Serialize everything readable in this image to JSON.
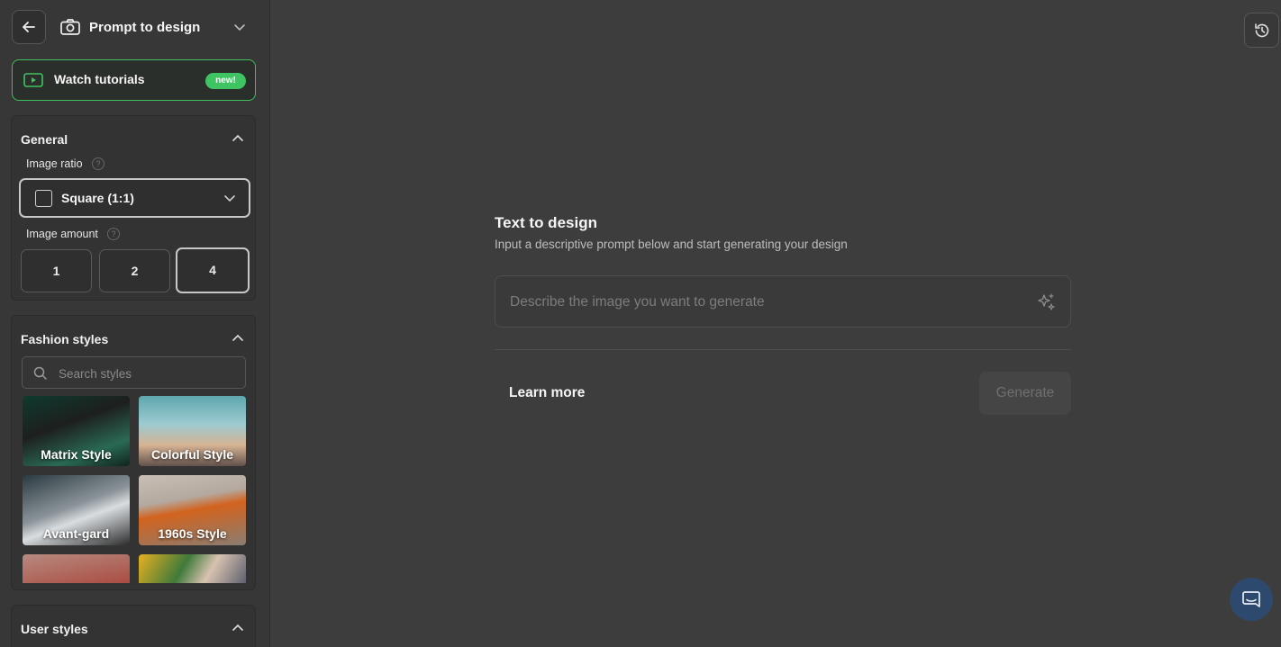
{
  "sidebar": {
    "mode_title": "Prompt to design",
    "tutorial": {
      "label": "Watch tutorials",
      "badge": "new!"
    },
    "general": {
      "title": "General",
      "image_ratio": {
        "label": "Image ratio",
        "help": "?",
        "value": "Square (1:1)"
      },
      "image_amount": {
        "label": "Image amount",
        "help": "?",
        "options": [
          "1",
          "2",
          "4"
        ],
        "selected": "4"
      }
    },
    "fashion_styles": {
      "title": "Fashion styles",
      "search_placeholder": "Search styles",
      "styles": [
        {
          "name": "Matrix Style"
        },
        {
          "name": "Colorful Style"
        },
        {
          "name": "Avant-gard"
        },
        {
          "name": "1960s Style"
        },
        {
          "name": ""
        },
        {
          "name": ""
        }
      ]
    },
    "user_styles": {
      "title": "User styles"
    }
  },
  "main": {
    "title": "Text to design",
    "subtitle": "Input a descriptive prompt below and start generating your design",
    "prompt_placeholder": "Describe the image you want to generate",
    "learn_more": "Learn more",
    "generate": "Generate"
  },
  "colors": {
    "accent_green": "#3ec462",
    "background": "#3d3d3d",
    "sidebar": "#373737"
  }
}
